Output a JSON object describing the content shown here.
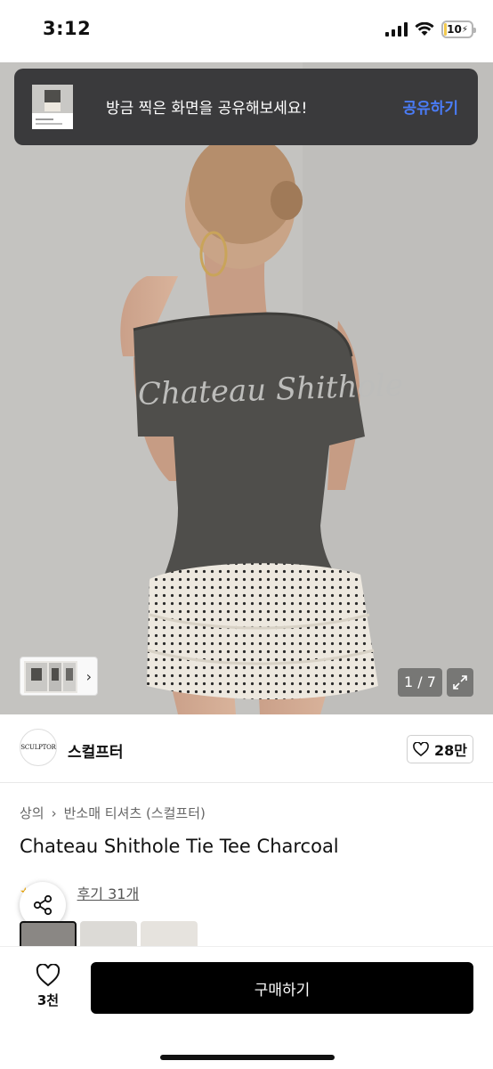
{
  "status_bar": {
    "time": "3:12",
    "battery": "10",
    "battery_level": 0.1
  },
  "toast": {
    "message": "방금 찍은 화면을 공유해보세요!",
    "action": "공유하기"
  },
  "gallery": {
    "counter": "1 / 7",
    "print_text": "Chateau Shithole"
  },
  "brand": {
    "logo_text": "SCULPTOR",
    "name": "스컬프터",
    "likes": "28만"
  },
  "breadcrumb": {
    "root": "상의",
    "category": "반소매 티셔츠 (스컬프터)"
  },
  "product": {
    "title": "Chateau Shithole Tie Tee Charcoal"
  },
  "reviews": {
    "link": "후기 31개"
  },
  "bottom": {
    "wish_count": "3천",
    "buy_label": "구매하기"
  },
  "colors": {
    "accent": "#4a7cf7",
    "buy": "#000000",
    "toast_bg": "#3a3a3c",
    "star": "#f2a900"
  }
}
